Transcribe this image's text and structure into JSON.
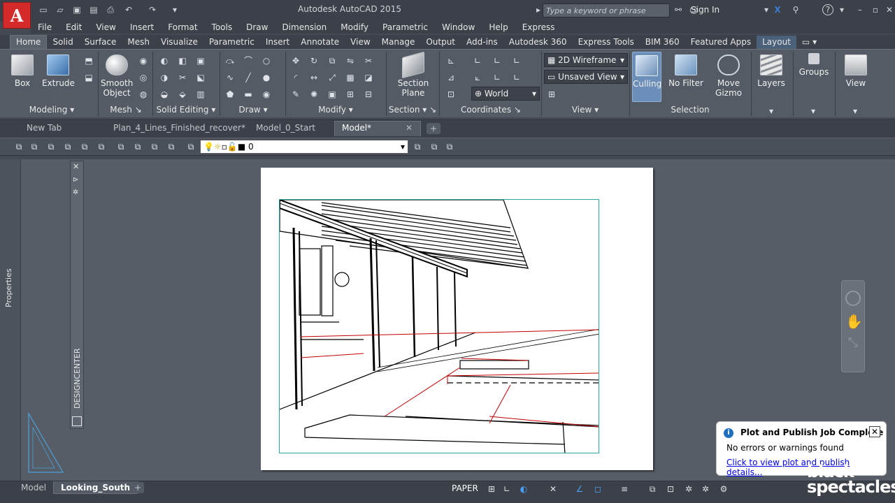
{
  "app": {
    "title": "Autodesk AutoCAD 2015",
    "logo_letter": "A"
  },
  "search": {
    "placeholder": "Type a keyword or phrase"
  },
  "signin": {
    "label": "Sign In"
  },
  "menu": [
    "File",
    "Edit",
    "View",
    "Insert",
    "Format",
    "Tools",
    "Draw",
    "Dimension",
    "Modify",
    "Parametric",
    "Window",
    "Help",
    "Express"
  ],
  "ribbon_tabs": [
    "Home",
    "Solid",
    "Surface",
    "Mesh",
    "Visualize",
    "Parametric",
    "Insert",
    "Annotate",
    "View",
    "Manage",
    "Output",
    "Add-ins",
    "Autodesk 360",
    "Express Tools",
    "BIM 360",
    "Featured Apps",
    "Layout"
  ],
  "ribbon_active_tab": "Home",
  "ribbon": {
    "box": "Box",
    "extrude": "Extrude",
    "smooth_object_1": "Smooth",
    "smooth_object_2": "Object",
    "section_plane_1": "Section",
    "section_plane_2": "Plane",
    "visual_style": "2D Wireframe",
    "view_name": "Unsaved View",
    "ucs": "World",
    "culling": "Culling",
    "no_filter": "No Filter",
    "move_gizmo_1": "Move",
    "move_gizmo_2": "Gizmo",
    "layers": "Layers",
    "groups": "Groups",
    "view": "View",
    "panels": {
      "modeling": "Modeling",
      "mesh": "Mesh",
      "solid_editing": "Solid Editing",
      "draw": "Draw",
      "modify": "Modify",
      "section": "Section",
      "coordinates": "Coordinates",
      "view": "View",
      "selection": "Selection"
    }
  },
  "doc_tabs": [
    "New Tab",
    "Plan_4_Lines_Finished_recover*",
    "Model_0_Start",
    "Model*"
  ],
  "active_doc_tab": "Model*",
  "layer": {
    "current": "0"
  },
  "palettes": {
    "properties": "Properties",
    "designcenter": "DESIGNCENTER"
  },
  "model_tabs": [
    "Model",
    "Looking_South"
  ],
  "active_model_tab": "Looking_South",
  "status": {
    "space": "PAPER"
  },
  "notification": {
    "title": "Plot and Publish Job Complete",
    "message": "No errors or warnings found",
    "link": "Click to view plot and publish details..."
  },
  "brand": {
    "line1": "black",
    "line2": "spectacles"
  },
  "colors": {
    "app_red": "#d42a2a",
    "viewport_border": "#2aa6a0",
    "link": "#0000ee"
  }
}
